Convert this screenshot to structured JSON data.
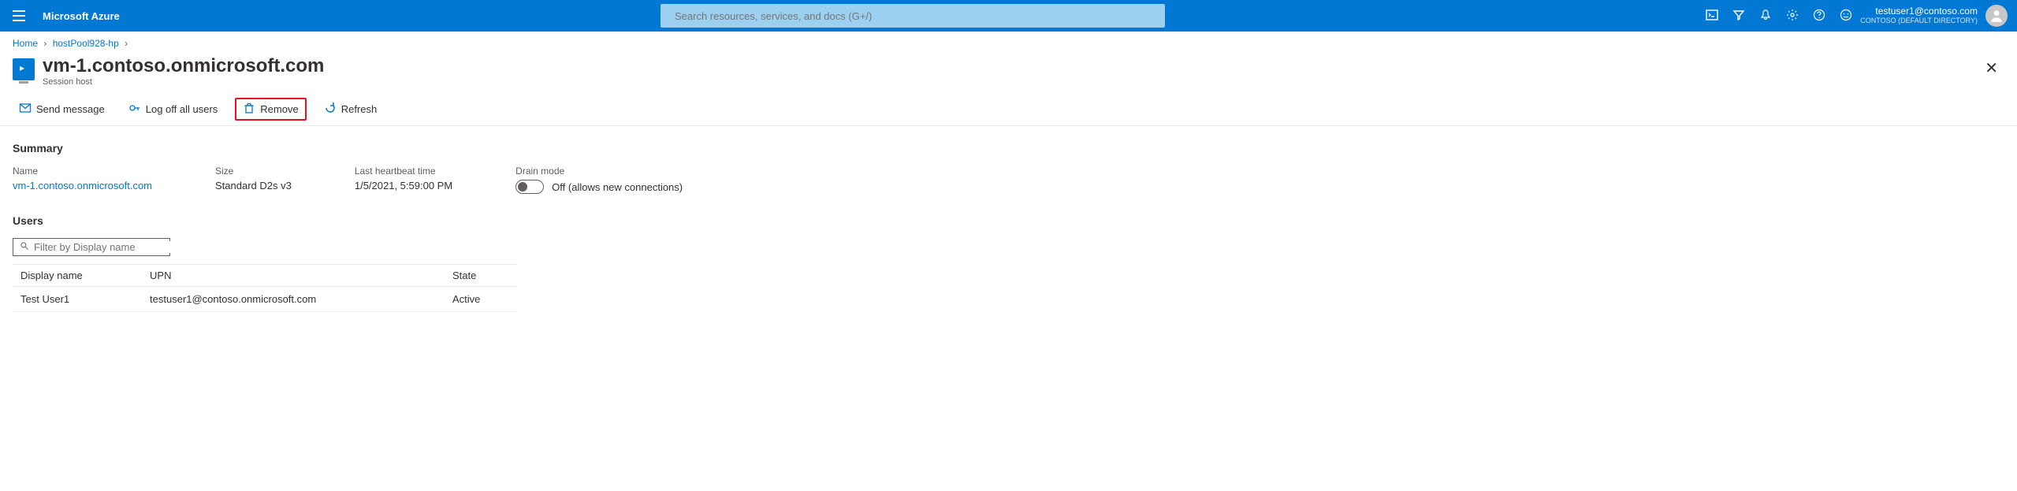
{
  "top": {
    "brand": "Microsoft Azure",
    "search_placeholder": "Search resources, services, and docs (G+/)",
    "account_email": "testuser1@contoso.com",
    "account_dir": "CONTOSO (DEFAULT DIRECTORY)"
  },
  "crumbs": {
    "home": "Home",
    "hostpool": "hostPool928-hp"
  },
  "page": {
    "title": "vm-1.contoso.onmicrosoft.com",
    "subtitle": "Session host"
  },
  "toolbar": {
    "send": "Send message",
    "logoff": "Log off all users",
    "remove": "Remove",
    "refresh": "Refresh"
  },
  "summary": {
    "heading": "Summary",
    "name_lbl": "Name",
    "name_val": "vm-1.contoso.onmicrosoft.com",
    "size_lbl": "Size",
    "size_val": "Standard D2s v3",
    "heartbeat_lbl": "Last heartbeat time",
    "heartbeat_val": "1/5/2021, 5:59:00 PM",
    "drain_lbl": "Drain mode",
    "drain_val": "Off (allows new connections)"
  },
  "users": {
    "heading": "Users",
    "filter_placeholder": "Filter by Display name",
    "cols": {
      "display": "Display name",
      "upn": "UPN",
      "state": "State"
    },
    "rows": [
      {
        "display": "Test User1",
        "upn": "testuser1@contoso.onmicrosoft.com",
        "state": "Active"
      }
    ]
  }
}
